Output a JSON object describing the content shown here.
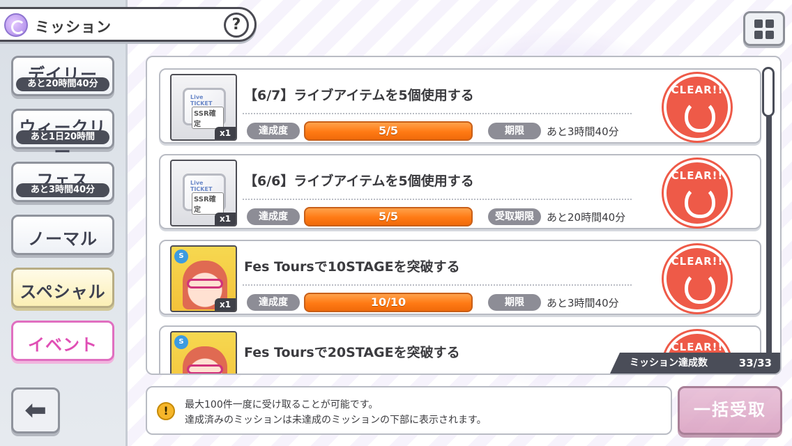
{
  "header": {
    "title": "ミッション",
    "help_label": "?"
  },
  "sidebar": {
    "items": [
      {
        "label": "デイリー",
        "sub": "あと20時間40分"
      },
      {
        "label": "ウィークリー",
        "sub": "あと1日20時間"
      },
      {
        "label": "フェス",
        "sub": "あと3時間40分"
      },
      {
        "label": "ノーマル"
      },
      {
        "label": "スペシャル"
      },
      {
        "label": "イベント"
      }
    ],
    "back_label": "⬅"
  },
  "missions": [
    {
      "title": "【6/7】ライブアイテムを5個使用する",
      "reward_type": "ticket",
      "ticket_top": "Live TICKET",
      "ticket_label": "SSR確定",
      "quantity": "x1",
      "progress_label": "達成度",
      "progress": "5/5",
      "progress_fraction": 1.0,
      "deadline_label": "期限",
      "deadline": "あと3時間40分",
      "status": "CLEAR!!"
    },
    {
      "title": "【6/6】ライブアイテムを5個使用する",
      "reward_type": "ticket",
      "ticket_top": "Live TICKET",
      "ticket_label": "SSR確定",
      "quantity": "x1",
      "progress_label": "達成度",
      "progress": "5/5",
      "progress_fraction": 1.0,
      "deadline_label": "受取期限",
      "deadline": "あと20時間40分",
      "status": "CLEAR!!"
    },
    {
      "title": "Fes Toursで10STAGEを突破する",
      "reward_type": "card",
      "card_badge": "S",
      "quantity": "x1",
      "progress_label": "達成度",
      "progress": "10/10",
      "progress_fraction": 1.0,
      "deadline_label": "期限",
      "deadline": "あと3時間40分",
      "status": "CLEAR!!"
    },
    {
      "title": "Fes Toursで20STAGEを突破する",
      "reward_type": "card",
      "card_badge": "S",
      "status": "CLEAR!!"
    }
  ],
  "summary": {
    "label": "ミッション達成数",
    "value": "33/33"
  },
  "info": {
    "icon": "!",
    "line1": "最大100件一度に受け取ることが可能です。",
    "line2": "達成済みのミッションは未達成のミッションの下部に表示されます。"
  },
  "claim_all_label": "一括受取",
  "colors": {
    "accent_orange": "#ff7a14",
    "clear_red": "#ee5a48",
    "event_pink": "#e04fb5"
  }
}
